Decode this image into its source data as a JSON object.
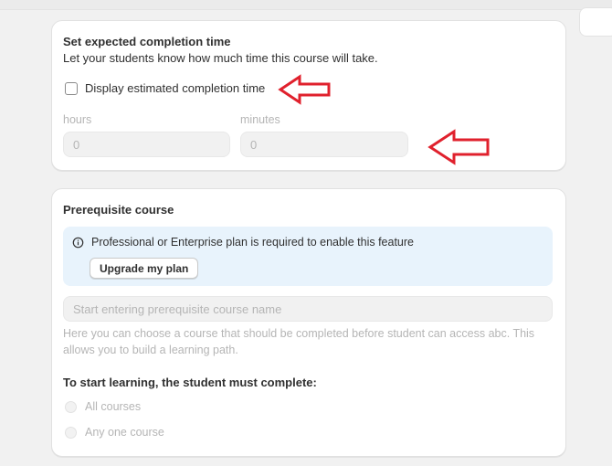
{
  "completion_section": {
    "title": "Set expected completion time",
    "subtitle": "Let your students know how much time this course will take.",
    "checkbox_label": "Display estimated completion time",
    "hours_label": "hours",
    "hours_value": "0",
    "minutes_label": "minutes",
    "minutes_value": "0"
  },
  "prerequisite_section": {
    "title": "Prerequisite course",
    "banner_text": "Professional or Enterprise plan is required to enable this feature",
    "upgrade_button": "Upgrade my plan",
    "search_placeholder": "Start entering prerequisite course name",
    "help_text": "Here you can choose a course that should be completed before student can access abc. This allows you to build a learning path.",
    "complete_label": "To start learning, the student must complete:",
    "options": [
      "All courses",
      "Any one course"
    ]
  },
  "annotation_color": "#e0212d",
  "banner_color": "#e8f3fc"
}
